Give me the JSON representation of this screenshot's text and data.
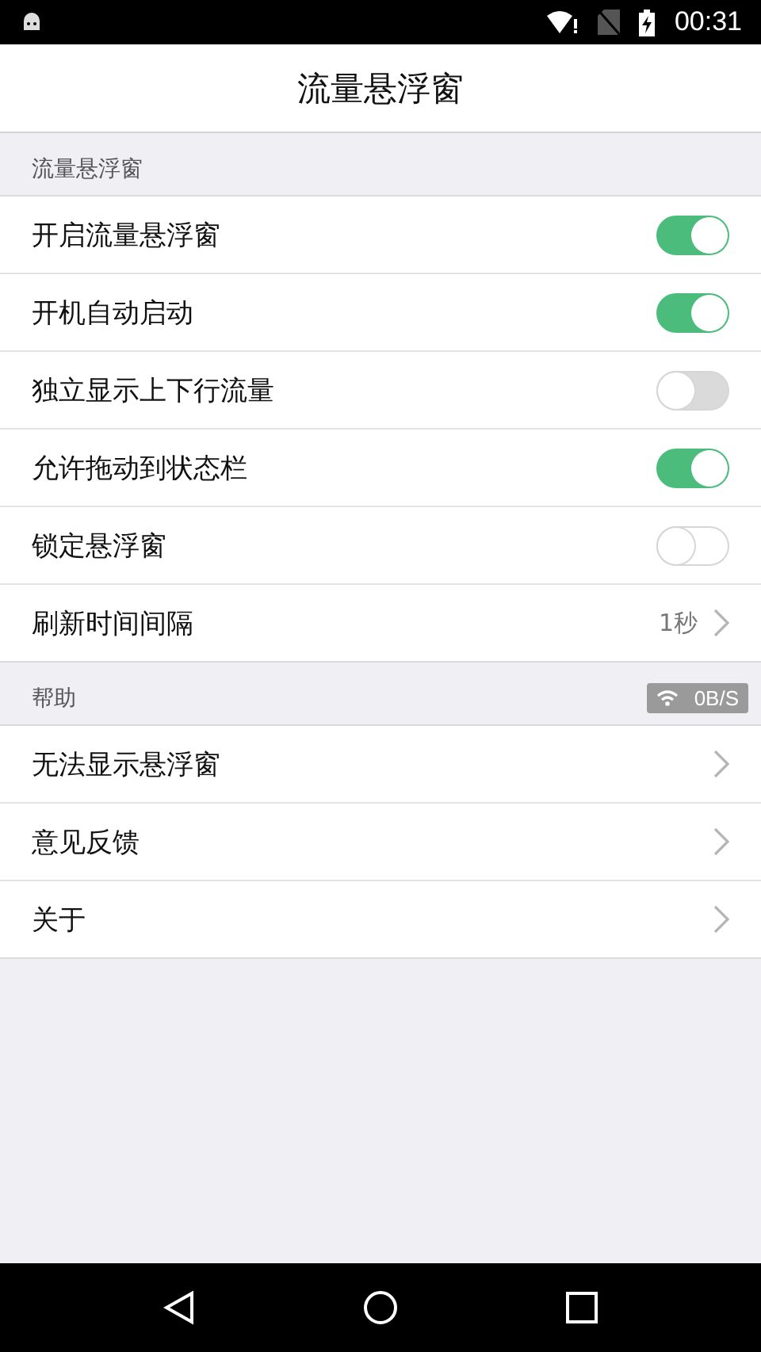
{
  "status_bar": {
    "time": "00:31"
  },
  "title": "流量悬浮窗",
  "sections": [
    {
      "header": "流量悬浮窗",
      "items": [
        {
          "kind": "toggle",
          "label": "开启流量悬浮窗",
          "on": true,
          "disabled": false
        },
        {
          "kind": "toggle",
          "label": "开机自动启动",
          "on": true,
          "disabled": false
        },
        {
          "kind": "toggle",
          "label": "独立显示上下行流量",
          "on": false,
          "disabled": true
        },
        {
          "kind": "toggle",
          "label": "允许拖动到状态栏",
          "on": true,
          "disabled": false
        },
        {
          "kind": "toggle",
          "label": "锁定悬浮窗",
          "on": false,
          "disabled": false
        },
        {
          "kind": "link",
          "label": "刷新时间间隔",
          "value": "1秒"
        }
      ]
    },
    {
      "header": "帮助",
      "items": [
        {
          "kind": "link",
          "label": "无法显示悬浮窗"
        },
        {
          "kind": "link",
          "label": "意见反馈"
        },
        {
          "kind": "link",
          "label": "关于"
        }
      ]
    }
  ],
  "floating_window": {
    "speed": "0B/S"
  }
}
